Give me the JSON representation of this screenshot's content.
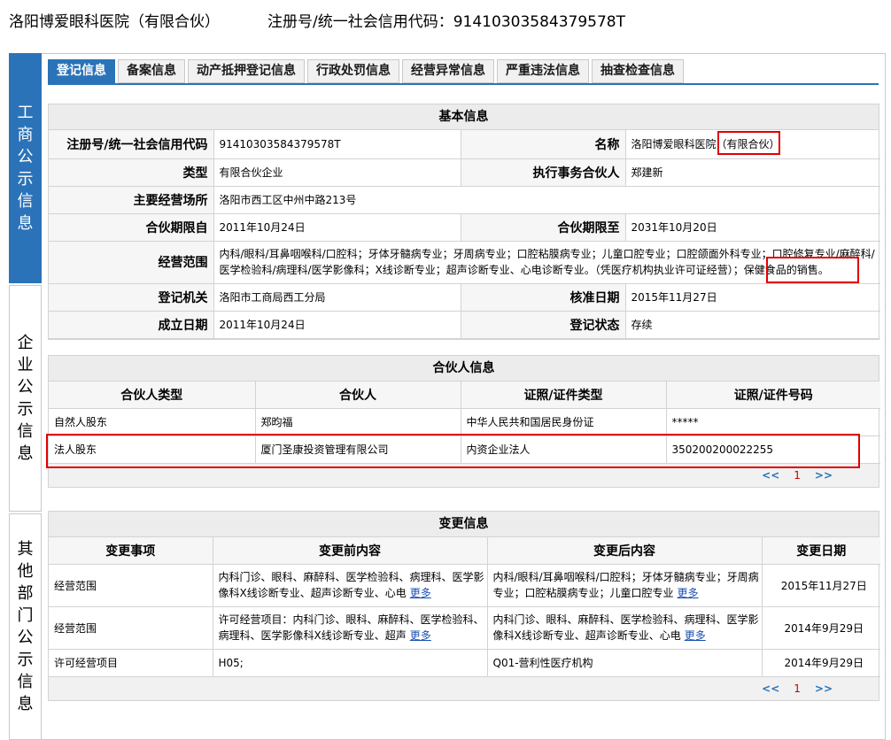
{
  "header": {
    "company_name": "洛阳博爱眼科医院（有限合伙）",
    "reg_label": "注册号/统一社会信用代码：",
    "reg_value": "91410303584379578T"
  },
  "left_nav": [
    {
      "label": "工商公示信息",
      "active": true
    },
    {
      "label": "企业公示信息",
      "active": false
    },
    {
      "label": "其他部门公示信息",
      "active": false
    }
  ],
  "tabs": [
    {
      "label": "登记信息",
      "active": true
    },
    {
      "label": "备案信息"
    },
    {
      "label": "动产抵押登记信息"
    },
    {
      "label": "行政处罚信息"
    },
    {
      "label": "经营异常信息"
    },
    {
      "label": "严重违法信息"
    },
    {
      "label": "抽查检查信息"
    }
  ],
  "basic": {
    "title": "基本信息",
    "reg_no_label": "注册号/统一社会信用代码",
    "reg_no": "91410303584379578T",
    "name_label": "名称",
    "name": "洛阳博爱眼科医院（有限合伙）",
    "type_label": "类型",
    "type": "有限合伙企业",
    "partner_label": "执行事务合伙人",
    "partner": "郑建新",
    "address_label": "主要经营场所",
    "address": "洛阳市西工区中州中路213号",
    "start_label": "合伙期限自",
    "start": "2011年10月24日",
    "end_label": "合伙期限至",
    "end": "2031年10月20日",
    "scope_label": "经营范围",
    "scope": "内科/眼科/耳鼻咽喉科/口腔科；牙体牙髓病专业；牙周病专业；口腔粘膜病专业；儿童口腔专业；口腔颌面外科专业；口腔修复专业/麻醉科/医学检验科/病理科/医学影像科；X线诊断专业；超声诊断专业、心电诊断专业。（凭医疗机构执业许可证经营）；保健食品的销售。",
    "authority_label": "登记机关",
    "authority": "洛阳市工商局西工分局",
    "approve_label": "核准日期",
    "approve": "2015年11月27日",
    "founded_label": "成立日期",
    "founded": "2011年10月24日",
    "status_label": "登记状态",
    "status": "存续"
  },
  "partners": {
    "title": "合伙人信息",
    "headers": [
      "合伙人类型",
      "合伙人",
      "证照/证件类型",
      "证照/证件号码"
    ],
    "rows": [
      [
        "自然人股东",
        "郑昀福",
        "中华人民共和国居民身份证",
        "*****"
      ],
      [
        "法人股东",
        "厦门圣康投资管理有限公司",
        "内资企业法人",
        "350200200022255"
      ]
    ],
    "pager": {
      "prev": "<<",
      "page": "1",
      "next": ">>"
    }
  },
  "changes": {
    "title": "变更信息",
    "headers": [
      "变更事项",
      "变更前内容",
      "变更后内容",
      "变更日期"
    ],
    "more_label": "更多",
    "rows": [
      {
        "item": "经营范围",
        "before": "内科门诊、眼科、麻醉科、医学检验科、病理科、医学影像科X线诊断专业、超声诊断专业、心电",
        "after": "内科/眼科/耳鼻咽喉科/口腔科；牙体牙髓病专业；牙周病专业；口腔粘膜病专业；儿童口腔专业",
        "date": "2015年11月27日"
      },
      {
        "item": "经营范围",
        "before": "许可经营项目：内科门诊、眼科、麻醉科、医学检验科、病理科、医学影像科X线诊断专业、超声",
        "after": "内科门诊、眼科、麻醉科、医学检验科、病理科、医学影像科X线诊断专业、超声诊断专业、心电",
        "date": "2014年9月29日"
      },
      {
        "item": "许可经营项目",
        "before": "H05;",
        "after": "Q01-营利性医疗机构",
        "date": "2014年9月29日"
      }
    ],
    "pager": {
      "prev": "<<",
      "page": "1",
      "next": ">>"
    }
  },
  "colors": {
    "accent": "#2b73b8",
    "highlight": "#e00000"
  }
}
